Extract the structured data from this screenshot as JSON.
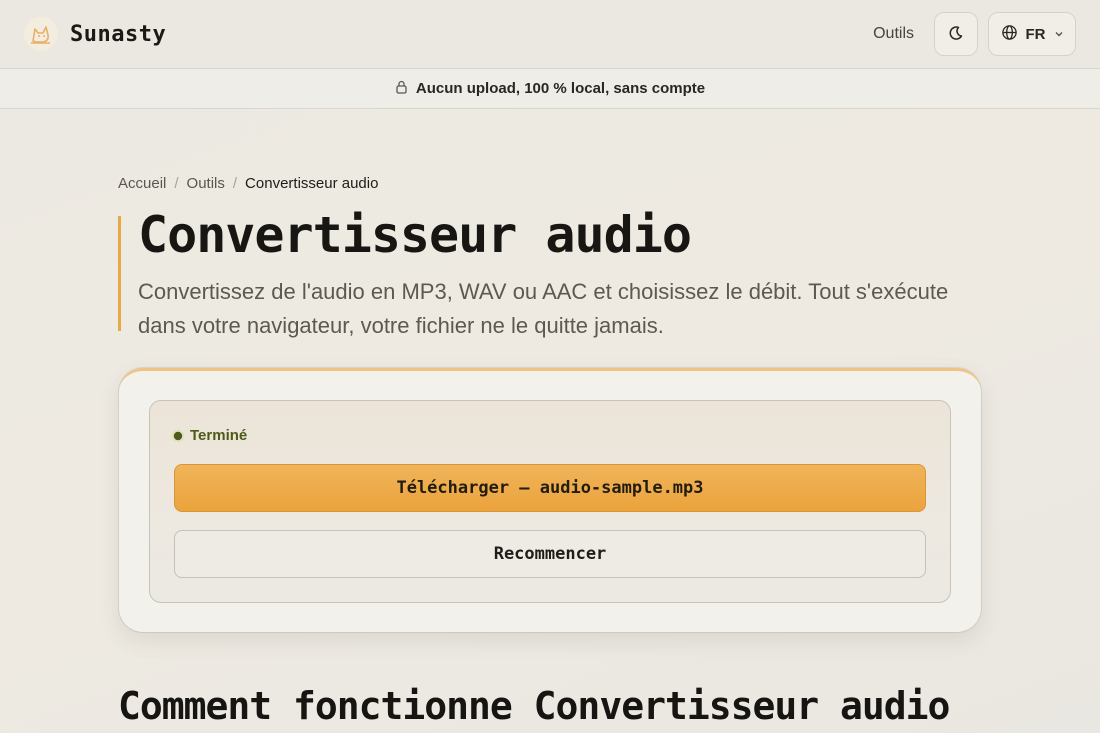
{
  "header": {
    "brand": "Sunasty",
    "nav_tools": "Outils",
    "language": "FR"
  },
  "banner": {
    "text": "Aucun upload, 100 % local, sans compte"
  },
  "breadcrumb": {
    "items": [
      "Accueil",
      "Outils",
      "Convertisseur audio"
    ]
  },
  "hero": {
    "title": "Convertisseur audio",
    "subtitle": "Convertissez de l'audio en MP3, WAV ou AAC et choisissez le débit. Tout s'exécute dans votre navigateur, votre fichier ne le quitte jamais."
  },
  "result": {
    "status": "Terminé",
    "download_label": "Télécharger — audio-sample.mp3",
    "restart_label": "Recommencer"
  },
  "section": {
    "title": "Comment fonctionne Convertisseur audio"
  },
  "colors": {
    "accent": "#eba33c",
    "status_green": "#4d5c1a"
  },
  "icons": {
    "logo": "cat-logo-icon",
    "theme": "moon-icon",
    "language": "globe-icon",
    "dropdown": "chevron-down-icon",
    "banner": "lock-icon"
  }
}
